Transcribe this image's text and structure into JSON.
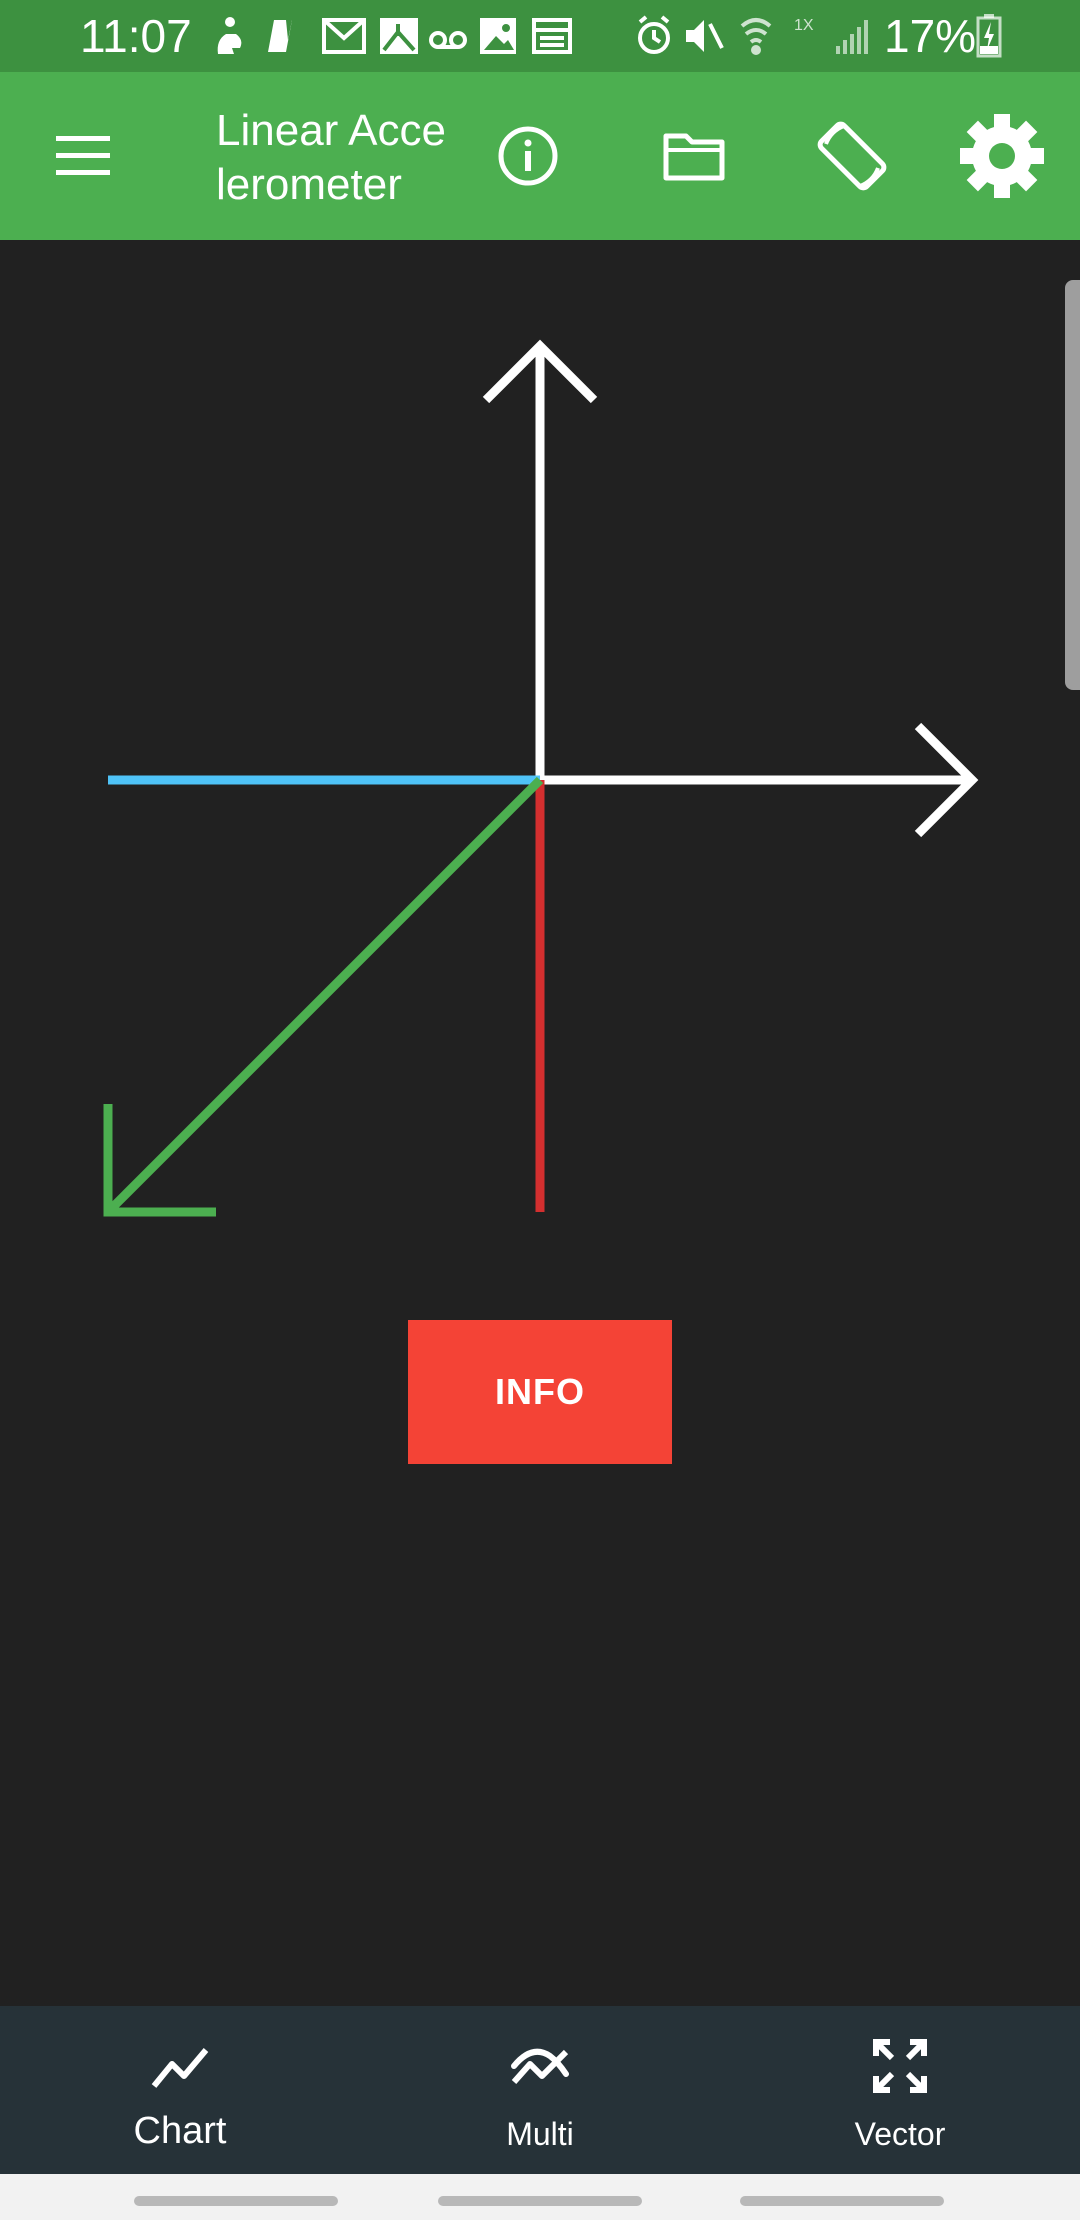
{
  "status_bar": {
    "time": "11:07",
    "battery_percent": "17%",
    "notification_icons": [
      "person-icon",
      "flipboard-icon",
      "gmail-icon",
      "news-icon",
      "voicemail-icon",
      "image-icon",
      "calendar-icon"
    ],
    "system_icons": [
      "alarm-icon",
      "mute-icon",
      "wifi-icon",
      "signal-icon",
      "battery-charging-icon"
    ]
  },
  "app_bar": {
    "title": "Linear Accelerometer",
    "actions": [
      "info-icon",
      "folder-icon",
      "screen-rotation-icon",
      "settings-icon"
    ]
  },
  "vector_view": {
    "colors": {
      "axes": "#ffffff",
      "x_component": "#4fc3f7",
      "y_component": "#d32f2f",
      "z_component": "#4caf50"
    }
  },
  "info_button": {
    "label": "INFO",
    "color": "#f44336"
  },
  "bottom_nav": {
    "items": [
      {
        "label": "Chart",
        "icon": "chart-line-icon",
        "active": true
      },
      {
        "label": "Multi",
        "icon": "multi-chart-icon",
        "active": false
      },
      {
        "label": "Vector",
        "icon": "vector-expand-icon",
        "active": false
      }
    ]
  },
  "theme": {
    "primary": "#4caf50",
    "status_bar": "#3d9140",
    "background": "#212121",
    "nav_background": "#263238"
  }
}
